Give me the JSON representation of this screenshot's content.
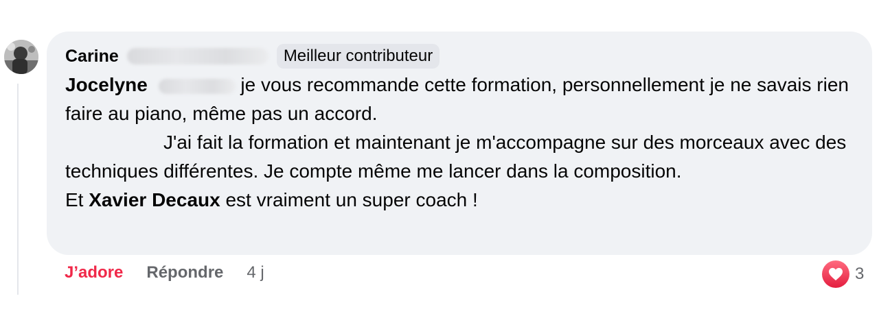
{
  "comment": {
    "author_first": "Carine",
    "badge": "Meilleur contributeur",
    "mention_first": "Jocelyne",
    "text_1": " je vous recommande cette formation, personnellement je ne savais rien faire au piano, même pas un accord.",
    "text_2": "J'ai fait la formation et maintenant je m'accompagne sur des morceaux avec des techniques différentes. Je compte même me lancer dans la composition.",
    "text_3_prefix": "Et ",
    "mention_coach": "Xavier Decaux",
    "text_3_suffix": " est vraiment un super coach !"
  },
  "actions": {
    "like_label": "J’adore",
    "reply_label": "Répondre",
    "time": "4 j"
  },
  "reactions": {
    "icon": "heart-icon",
    "count": "3",
    "color": "#f02849"
  },
  "colors": {
    "bubble_bg": "#f0f2f5",
    "secondary_text": "#65676b",
    "accent": "#f02849"
  }
}
